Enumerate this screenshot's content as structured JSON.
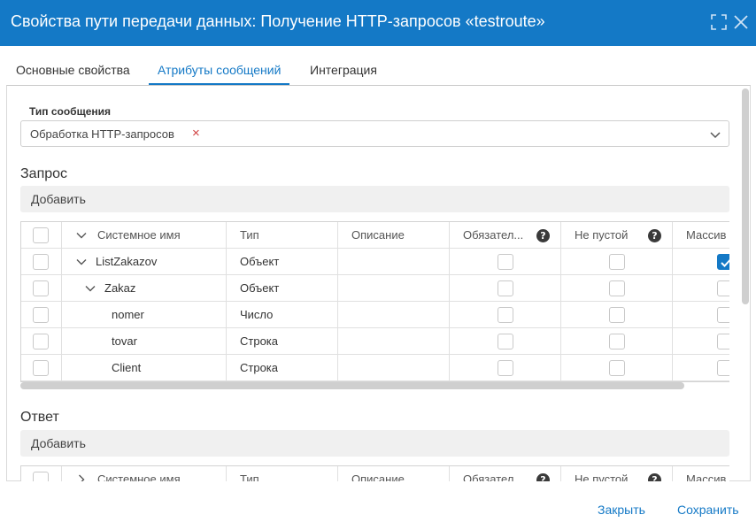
{
  "dialog": {
    "title": "Свойства пути передачи данных: Получение HTTP-запросов «testroute»",
    "accent": "#1479c6"
  },
  "tabs": [
    {
      "label": "Основные свойства",
      "active": false
    },
    {
      "label": "Атрибуты сообщений",
      "active": true
    },
    {
      "label": "Интеграция",
      "active": false
    }
  ],
  "message_type": {
    "label": "Тип сообщения",
    "value": "Обработка HTTP-запросов",
    "clear_glyph": "×"
  },
  "request": {
    "title": "Запрос",
    "add_label": "Добавить",
    "columns": [
      "Системное имя",
      "Тип",
      "Описание",
      "Обязател...",
      "Не пустой",
      "Массив"
    ],
    "rows": [
      {
        "name": "ListZakazov",
        "type": "Объект",
        "required": false,
        "nonempty": false,
        "array": true
      },
      {
        "name": "Zakaz",
        "type": "Объект",
        "required": false,
        "nonempty": false,
        "array": false
      },
      {
        "name": "nomer",
        "type": "Число",
        "required": false,
        "nonempty": false,
        "array": false
      },
      {
        "name": "tovar",
        "type": "Строка",
        "required": false,
        "nonempty": false,
        "array": false
      },
      {
        "name": "Client",
        "type": "Строка",
        "required": false,
        "nonempty": false,
        "array": false
      }
    ]
  },
  "response": {
    "title": "Ответ",
    "add_label": "Добавить",
    "columns": [
      "Системное имя",
      "Тип",
      "Описание",
      "Обязател...",
      "Не пустой",
      "Массив"
    ]
  },
  "help_glyph": "?",
  "footer": {
    "close_label": "Закрыть",
    "save_label": "Сохранить"
  }
}
